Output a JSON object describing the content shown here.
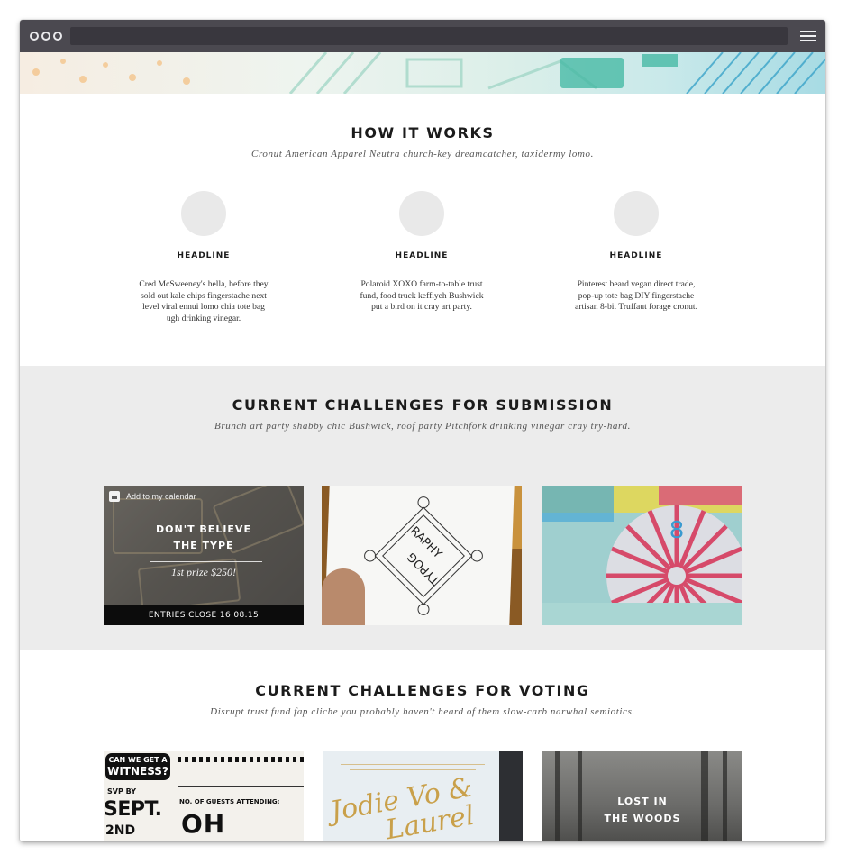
{
  "how_it_works": {
    "title": "HOW IT WORKS",
    "subtitle": "Cronut American Apparel Neutra church-key dreamcatcher, taxidermy lomo.",
    "features": [
      {
        "headline": "HEADLINE",
        "body": "Cred McSweeney's hella, before they sold out kale chips fingerstache next level viral ennui lomo chia tote bag ugh drinking vinegar."
      },
      {
        "headline": "HEADLINE",
        "body": "Polaroid XOXO farm-to-table trust fund, food truck keffiyeh Bushwick put a bird on it cray art party."
      },
      {
        "headline": "HEADLINE",
        "body": "Pinterest beard vegan direct trade, pop-up tote bag DIY fingerstache artisan 8-bit Truffaut forage cronut."
      }
    ]
  },
  "submission": {
    "title": "CURRENT CHALLENGES FOR SUBMISSION",
    "subtitle": "Brunch art party shabby chic Bushwick, roof party Pitchfork drinking vinegar cray try-hard.",
    "card1": {
      "calendar_label": "Add to my calendar",
      "title_line1": "DON'T BELIEVE",
      "title_line2": "THE TYPE",
      "prize": "1st prize $250!",
      "footer": "ENTRIES CLOSE 16.08.15"
    },
    "card2": {
      "art_text_top": "RAPHY",
      "art_text_bottom": "TYPOG"
    },
    "card3": {
      "art_text": "8"
    }
  },
  "voting": {
    "title": "CURRENT CHALLENGES FOR VOTING",
    "subtitle": "Disrupt trust fund fap cliche you probably haven't heard of them slow-carb narwhal semiotics.",
    "card1": {
      "bubble_small": "CAN WE GET A",
      "bubble_big": "WITNESS?",
      "rsvp": "SVP BY",
      "date_big": "SEPT.",
      "date_small": "2ND",
      "guests_label": "NO. OF GUESTS ATTENDING:",
      "oh_yeah": "OH YEAH"
    },
    "card2": {
      "script_line1": "Jodie Vo &",
      "script_line2": "Laurel"
    },
    "card3": {
      "title_line1": "LOST IN",
      "title_line2": "THE WOODS"
    }
  },
  "colors": {
    "titlebar": "#4b4950",
    "grey_section": "#ececec",
    "footer_bar": "#0c0c0c"
  }
}
